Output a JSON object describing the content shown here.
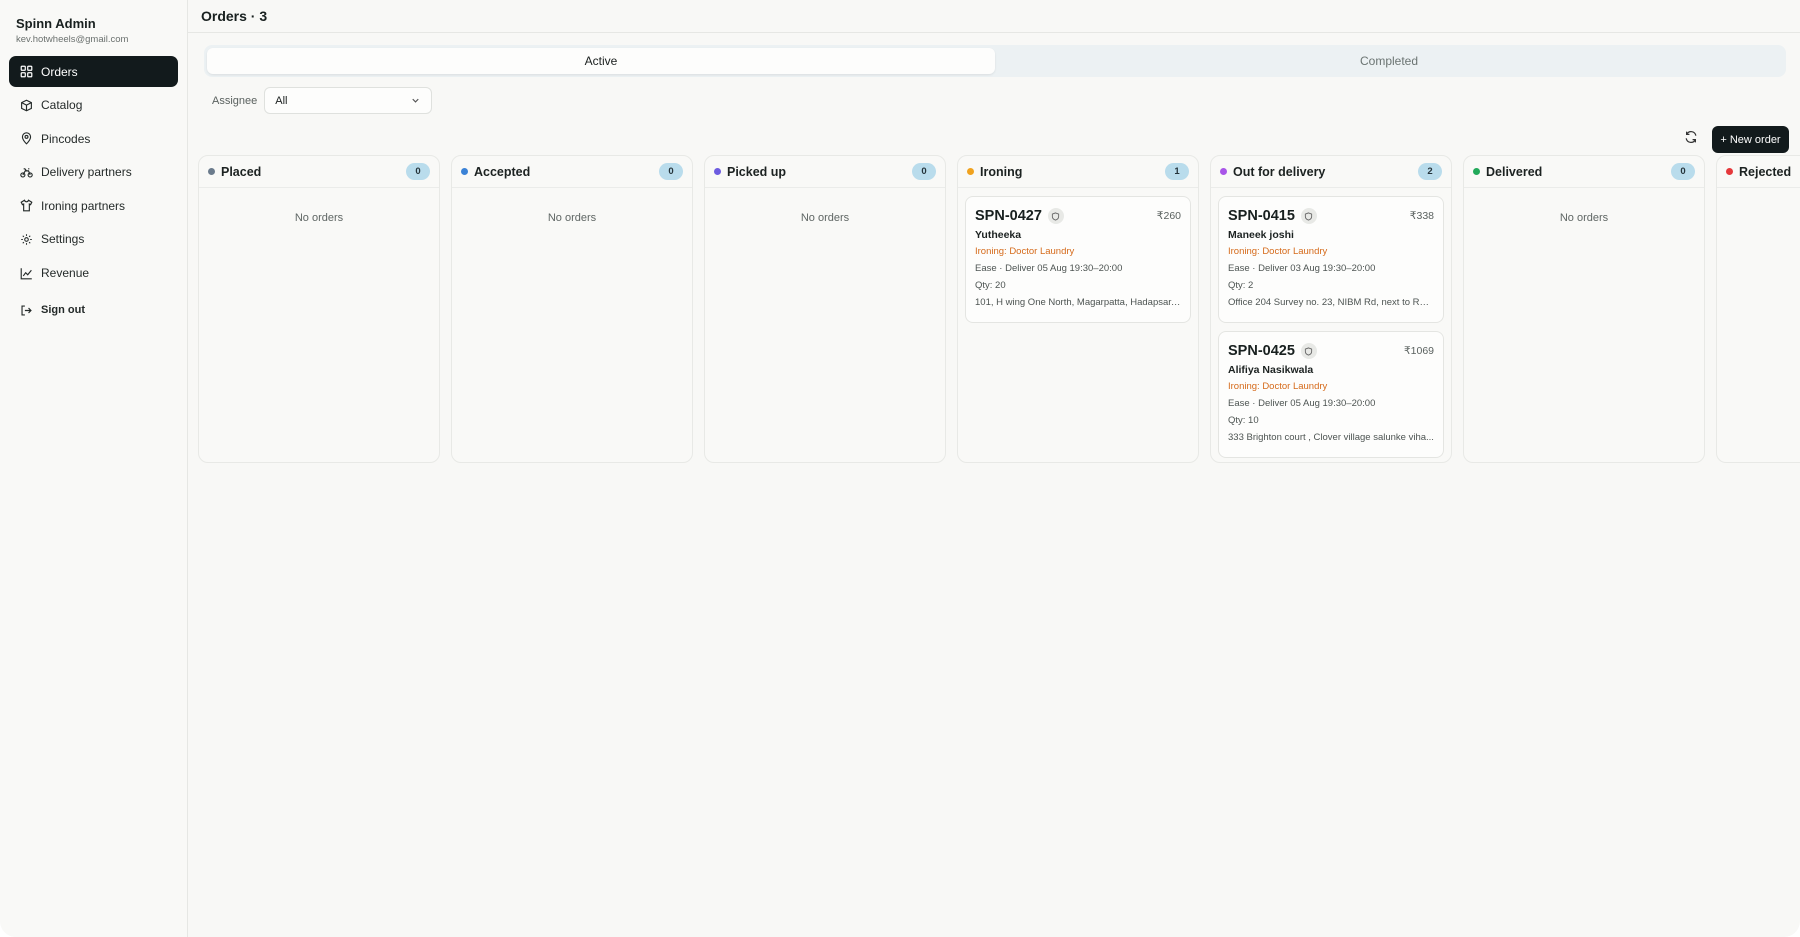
{
  "sidebar": {
    "brand_name": "Spinn Admin",
    "brand_email": "kev.hotwheels@gmail.com",
    "items": [
      {
        "label": "Orders",
        "icon": "grid-icon"
      },
      {
        "label": "Catalog",
        "icon": "package-icon"
      },
      {
        "label": "Pincodes",
        "icon": "map-pin-icon"
      },
      {
        "label": "Delivery partners",
        "icon": "bike-icon"
      },
      {
        "label": "Ironing partners",
        "icon": "shirt-icon"
      },
      {
        "label": "Settings",
        "icon": "gear-icon"
      },
      {
        "label": "Revenue",
        "icon": "line-chart-icon"
      }
    ],
    "sign_out": "Sign out"
  },
  "header": {
    "title": "Orders · 3"
  },
  "tabs": [
    {
      "label": "Active",
      "selected": true
    },
    {
      "label": "Completed",
      "selected": false
    }
  ],
  "filter": {
    "label": "Assignee",
    "value": "All"
  },
  "toolbar": {
    "new_order_label": "+ New order"
  },
  "board": {
    "columns": [
      {
        "title": "Placed",
        "count": "0",
        "color": "#6b7b8c",
        "empty": "No orders"
      },
      {
        "title": "Accepted",
        "count": "0",
        "color": "#3b82d6",
        "empty": "No orders"
      },
      {
        "title": "Picked up",
        "count": "0",
        "color": "#6d5ce0",
        "empty": "No orders"
      },
      {
        "title": "Ironing",
        "count": "1",
        "color": "#f0a21e",
        "empty": ""
      },
      {
        "title": "Out for delivery",
        "count": "2",
        "color": "#a855e8",
        "empty": ""
      },
      {
        "title": "Delivered",
        "count": "0",
        "color": "#22a95a",
        "empty": "No orders"
      },
      {
        "title": "Rejected",
        "count": "",
        "color": "#e5383b",
        "empty": ""
      }
    ],
    "cards": {
      "ironing": [
        {
          "id": "SPN-0427",
          "price": "₹260",
          "name": "Yutheeka",
          "ironing": "Ironing: Doctor Laundry",
          "delivery": "Ease · Deliver 05 Aug 19:30–20:00",
          "qty": "Qty: 20",
          "address": "101, H wing One North, Magarpatta, Hadapsar, P..."
        }
      ],
      "out_for_delivery": [
        {
          "id": "SPN-0415",
          "price": "₹338",
          "name": "Maneek joshi",
          "ironing": "Ironing: Doctor Laundry",
          "delivery": "Ease · Deliver 03 Aug 19:30–20:00",
          "qty": "Qty: 2",
          "address": "Office 204 Survey no. 23, NIBM Rd, next to Run..."
        },
        {
          "id": "SPN-0425",
          "price": "₹1069",
          "name": "Alifiya Nasikwala",
          "ironing": "Ironing: Doctor Laundry",
          "delivery": "Ease · Deliver 05 Aug 19:30–20:00",
          "qty": "Qty: 10",
          "address": "333 Brighton court , Clover village salunke viha..."
        }
      ]
    }
  },
  "colors": {
    "accent_dark": "#121a1c",
    "badge_bg": "#b9dcec",
    "ironing_text": "#d56a1a"
  }
}
